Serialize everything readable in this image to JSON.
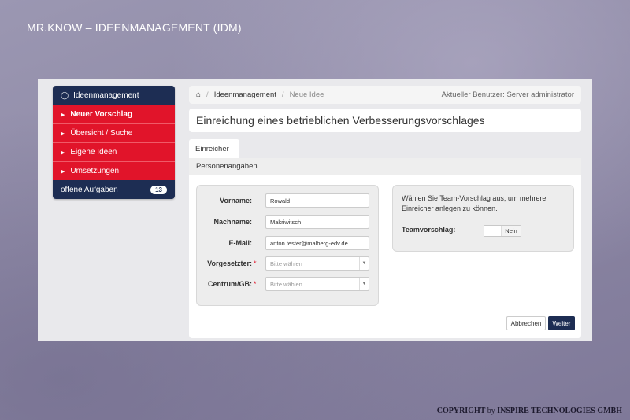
{
  "slide": {
    "title": "MR.KNOW – IDEENMANAGEMENT (IDM)",
    "copyright_prefix": "COPYRIGHT",
    "copyright_by": "by",
    "copyright_company": "INSPIRE TECHNOLOGIES GMBH"
  },
  "sidebar": {
    "header_icon": "lightbulb-icon",
    "header": "Ideenmanagement",
    "items": [
      {
        "label": "Neuer Vorschlag",
        "active": true
      },
      {
        "label": "Übersicht / Suche",
        "active": false
      },
      {
        "label": "Eigene Ideen",
        "active": false
      },
      {
        "label": "Umsetzungen",
        "active": false
      }
    ],
    "footer_label": "offene Aufgaben",
    "footer_badge": "13"
  },
  "breadcrumb": {
    "home_icon": "home-icon",
    "items": [
      "Ideenmanagement",
      "Neue Idee"
    ],
    "user": "Aktueller Benutzer: Server administrator"
  },
  "page_title": "Einreichung eines betrieblichen Verbesserungsvorschlages",
  "tab": "Einreicher",
  "panel_header": "Personenangaben",
  "form": {
    "first_name": {
      "label": "Vorname:",
      "value": "Rowald"
    },
    "last_name": {
      "label": "Nachname:",
      "value": "Makriwitsch"
    },
    "email": {
      "label": "E-Mail:",
      "value": "anton.tester@malberg-edv.de"
    },
    "supervisor": {
      "label": "Vorgesetzter:",
      "required": "*",
      "placeholder": "Bitte wählen"
    },
    "center": {
      "label": "Centrum/GB:",
      "required": "*",
      "placeholder": "Bitte wählen"
    }
  },
  "team": {
    "text": "Wählen Sie Team-Vorschlag aus, um mehrere Einreicher anlegen zu können.",
    "label": "Teamvorschlag:",
    "toggle_value": "Nein"
  },
  "buttons": {
    "cancel": "Abbrechen",
    "next": "Weiter"
  },
  "colors": {
    "navy": "#1d2d53",
    "red": "#e1142a"
  }
}
